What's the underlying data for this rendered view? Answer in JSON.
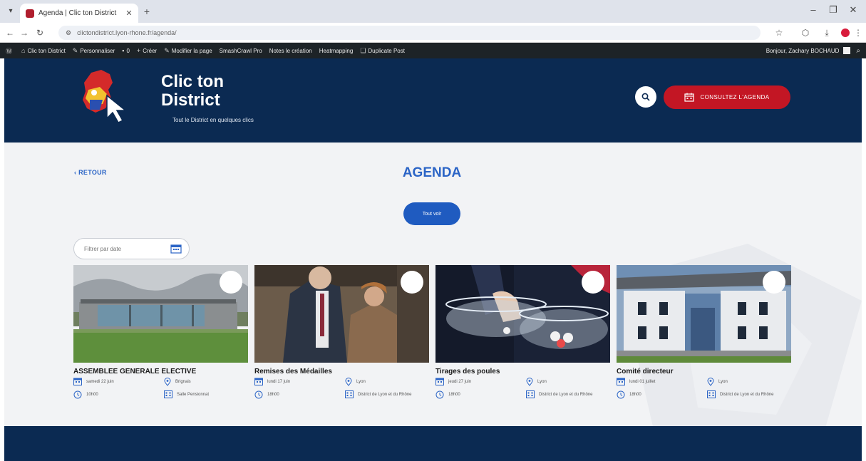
{
  "browser": {
    "tab_title": "Agenda | Clic ton District",
    "url": "clictondistrict.lyon-rhone.fr/agenda/"
  },
  "adminbar": {
    "items": [
      "Clic ton District",
      "Personnaliser",
      "0",
      "Créer",
      "Modifier la page",
      "SmashCrawl Pro",
      "Notes le création",
      "Heatmapping",
      "Duplicate Post"
    ],
    "greeting": "Bonjour, Zachary BOCHAUD"
  },
  "site": {
    "title_line1": "Clic ton",
    "title_line2": "District",
    "tagline": "Tout le District en quelques clics",
    "cta_label": "CONSULTEZ L'AGENDA",
    "back_label": "‹ RETOUR",
    "page_title": "AGENDA",
    "all_button": "Tout voir",
    "date_filter_placeholder": "Filtrer par date"
  },
  "events": [
    {
      "title": "ASSEMBLEE GENERALE ELECTIVE",
      "date": "samedi 22 juin",
      "time": "10h00",
      "place": "Brignais",
      "venue": "Salle Pensionnat"
    },
    {
      "title": "Remises des Médailles",
      "date": "lundi 17 juin",
      "time": "18h00",
      "place": "Lyon",
      "venue": "District de Lyon et du Rhône"
    },
    {
      "title": "Tirages des poules",
      "date": "jeudi 27 juin",
      "time": "18h00",
      "place": "Lyon",
      "venue": "District de Lyon et du Rhône"
    },
    {
      "title": "Comité directeur",
      "date": "lundi 01 juillet",
      "time": "18h00",
      "place": "Lyon",
      "venue": "District de Lyon et du Rhône"
    }
  ],
  "colors": {
    "header_navy": "#0b2a52",
    "accent_red": "#c31624",
    "link_blue": "#2b64c6",
    "button_blue": "#1f5bc0"
  }
}
